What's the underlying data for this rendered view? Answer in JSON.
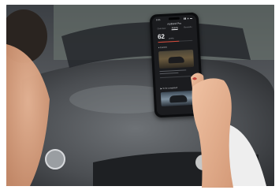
{
  "photo": {
    "subject": "hand-holding-smartphone-in-front-of-car"
  },
  "phone_screen": {
    "status_time": "9:41",
    "status_icons": "▮▮ ▲ ▬",
    "app_title": "myBond Pro",
    "tabs": [
      "Overview",
      "Activity",
      "Rewards"
    ],
    "active_tab_index": 1,
    "big_number": "62",
    "big_number_unit": "points",
    "progress": 0.62,
    "section_current": "● Current",
    "section_next": "▶ To be completed"
  },
  "colors": {
    "accent": "#d64a3a",
    "screen_bg": "#1b1c1f"
  }
}
